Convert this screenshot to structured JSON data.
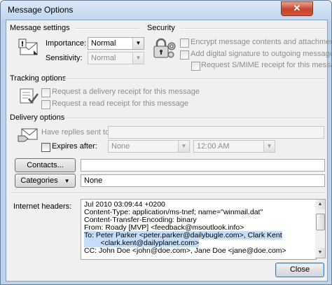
{
  "window": {
    "title": "Message Options",
    "close_glyph": "✕"
  },
  "message_settings": {
    "group_label": "Message settings",
    "importance_label": "Importance:",
    "importance_value": "Normal",
    "sensitivity_label": "Sensitivity:",
    "sensitivity_value": "Normal"
  },
  "security": {
    "group_label": "Security",
    "encrypt_label": "Encrypt message contents and attachments",
    "signature_label": "Add digital signature to outgoing message",
    "smime_label": "Request S/MIME receipt for this message"
  },
  "tracking": {
    "group_label": "Tracking options",
    "delivery_receipt_label": "Request a delivery receipt for this message",
    "read_receipt_label": "Request a read receipt for this message"
  },
  "delivery": {
    "group_label": "Delivery options",
    "replies_label": "Have replies sent to:",
    "expires_label": "Expires after:",
    "expires_date": "None",
    "expires_time": "12:00 AM"
  },
  "contacts": {
    "button_label": "Contacts...",
    "value": ""
  },
  "categories": {
    "button_label": "Categories",
    "arrow": "▼",
    "value": "None"
  },
  "internet_headers": {
    "label": "Internet headers:",
    "lines": [
      "Jul 2010 03:09:44 +0200",
      "Content-Type: application/ms-tnef; name=\"winmail.dat\"",
      "Content-Transfer-Encoding: binary",
      "From: Roady [MVP] <feedback@msoutlook.info>",
      "To: Peter Parker <peter.parker@dailybugle.com>, Clark Kent",
      "        <clark.kent@dailyplanet.com>",
      "CC: John Doe <john@doe.com>, Jane Doe <jane@doe.com>"
    ],
    "highlighted_line_indexes": [
      4,
      5
    ]
  },
  "footer": {
    "close_label": "Close"
  },
  "icons": {
    "message_settings": "envelope-importance-icon",
    "security": "padlock-gears-icon",
    "tracking": "receipt-check-icon",
    "delivery": "envelope-hand-icon"
  }
}
